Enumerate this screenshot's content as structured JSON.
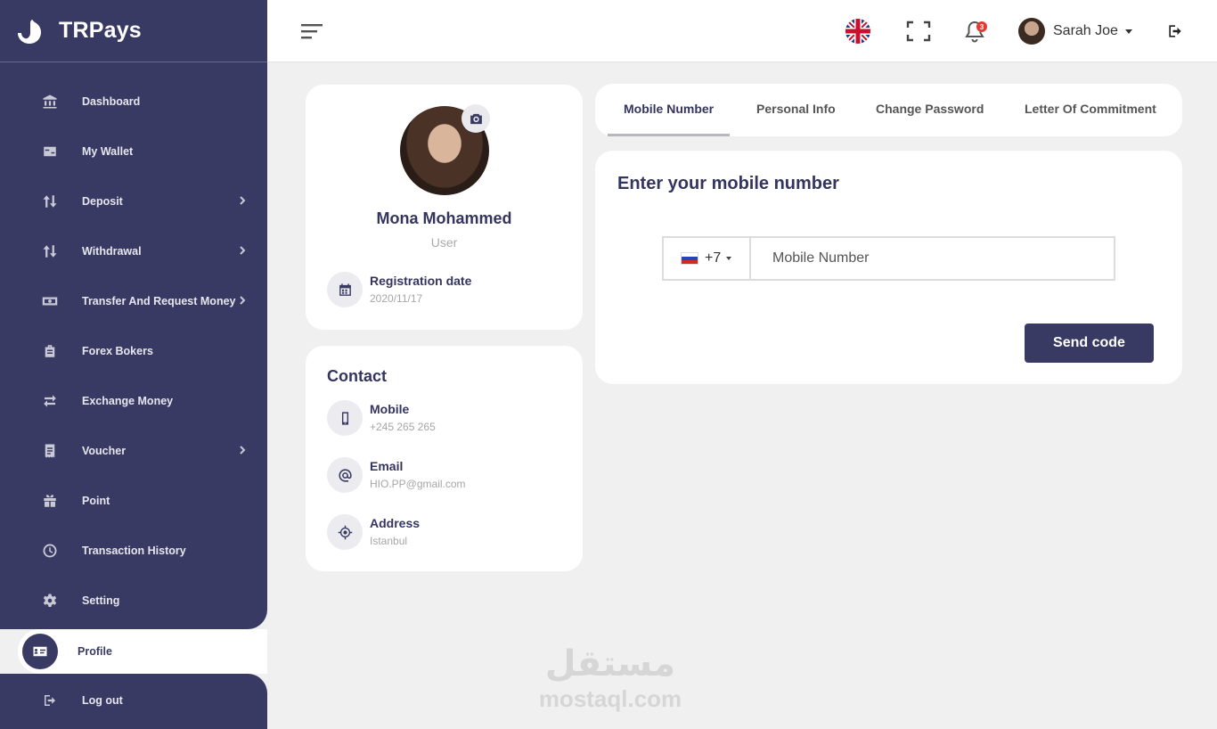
{
  "brand": {
    "name": "TRPays"
  },
  "sidebar": {
    "items": [
      {
        "label": "Dashboard",
        "icon": "bank-icon",
        "chevron": false
      },
      {
        "label": "My Wallet",
        "icon": "wallet-icon",
        "chevron": false
      },
      {
        "label": "Deposit",
        "icon": "arrows-updown-icon",
        "chevron": true
      },
      {
        "label": "Withdrawal",
        "icon": "arrows-updown-icon",
        "chevron": true
      },
      {
        "label": "Transfer And Request Money",
        "icon": "money-icon",
        "chevron": true
      },
      {
        "label": "Forex Bokers",
        "icon": "briefcase-icon",
        "chevron": false
      },
      {
        "label": "Exchange Money",
        "icon": "exchange-icon",
        "chevron": false
      },
      {
        "label": "Voucher",
        "icon": "receipt-icon",
        "chevron": true
      },
      {
        "label": "Point",
        "icon": "gift-icon",
        "chevron": false
      },
      {
        "label": "Transaction History",
        "icon": "clock-icon",
        "chevron": false
      },
      {
        "label": "Setting",
        "icon": "gear-icon",
        "chevron": false
      }
    ],
    "active": {
      "label": "Profile",
      "icon": "id-card-icon"
    },
    "logout": {
      "label": "Log out",
      "icon": "logout-icon"
    }
  },
  "header": {
    "language_icon": "uk-flag-icon",
    "notifications_count": "3",
    "user_name": "Sarah Joe"
  },
  "profile": {
    "name": "Mona Mohammed",
    "role": "User",
    "registration_label": "Registration date",
    "registration_date": "2020/11/17"
  },
  "contact": {
    "title": "Contact",
    "mobile_label": "Mobile",
    "mobile_value": "+245 265 265",
    "email_label": "Email",
    "email_value": "HIO.PP@gmail.com",
    "address_label": "Address",
    "address_value": "Istanbul"
  },
  "tabs": [
    {
      "label": "Mobile Number",
      "active": true
    },
    {
      "label": "Personal Info",
      "active": false
    },
    {
      "label": "Change Password",
      "active": false
    },
    {
      "label": "Letter Of Commitment",
      "active": false
    }
  ],
  "mobile_form": {
    "title": "Enter your mobile number",
    "country_flag": "russia-flag-icon",
    "dial_code": "+7",
    "placeholder": "Mobile Number",
    "value": "",
    "submit_label": "Send code"
  },
  "watermark": {
    "arabic": "مستقل",
    "latin": "mostaql.com"
  },
  "colors": {
    "primary": "#393a63",
    "background": "#f0f0f0",
    "badge": "#e53935"
  }
}
